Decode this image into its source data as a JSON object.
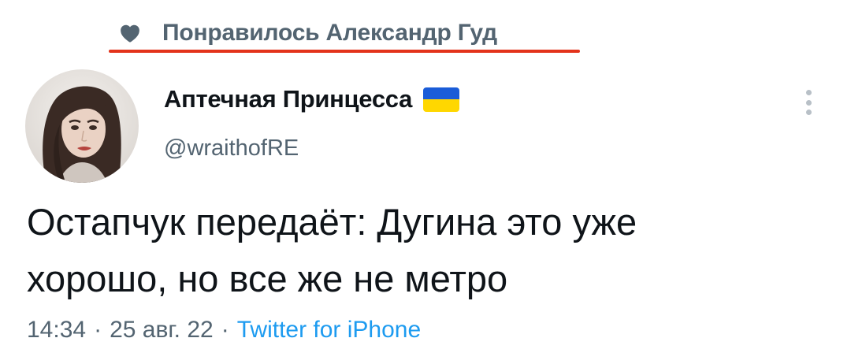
{
  "liked_banner": {
    "icon": "heart-icon",
    "text": "Понравилось Александр Гуд",
    "underline_color": "#e3331b"
  },
  "author": {
    "display_name": "Аптечная Принцесса",
    "badge_icon": "ukraine-flag-icon",
    "flag_colors": [
      "#1a5cd8",
      "#ffd700"
    ],
    "handle": "@wraithofRE"
  },
  "tweet": {
    "text_line1": "Остапчук передаёт: Дугина это уже",
    "text_line2": "хорошо, но все же не метро"
  },
  "meta": {
    "time": "14:34",
    "separator": "·",
    "date": "25 авг. 22",
    "source": "Twitter for iPhone",
    "source_color": "#1d9bf0"
  },
  "actions": {
    "more_icon": "more-vertical-icon"
  }
}
